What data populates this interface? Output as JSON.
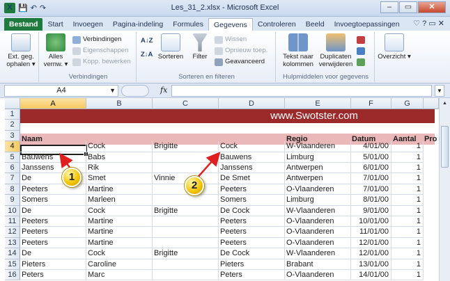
{
  "window": {
    "title": "Les_31_2.xlsx - Microsoft Excel",
    "minimize": "–",
    "restore": "▭",
    "close": "✕"
  },
  "qat": {
    "logo": "X",
    "save": "💾",
    "undo": "↶",
    "redo": "↷"
  },
  "tabs": [
    "Bestand",
    "Start",
    "Invoegen",
    "Pagina-indeling",
    "Formules",
    "Gegevens",
    "Controleren",
    "Beeld",
    "Invoegtoepassingen"
  ],
  "tabs_right": "♡ ? ▭ ✕",
  "ribbon": {
    "ext_label": "Ext. geg. ophalen ▾",
    "groups": {
      "verbindingen": {
        "label": "Verbindingen",
        "alles_vernw": "Alles vernw. ▾",
        "items": [
          "Verbindingen",
          "Eigenschappen",
          "Kopp. bewerken"
        ]
      },
      "sorteren": {
        "label": "Sorteren en filteren",
        "sort_az": "A↓Z",
        "sort_za": "Z↓A",
        "sorteren": "Sorteren",
        "filter": "Filter",
        "items": [
          "Wissen",
          "Opnieuw toep.",
          "Geavanceerd"
        ]
      },
      "hulpmiddelen": {
        "label": "Hulpmiddelen voor gegevens",
        "tekst_naar_kolommen": "Tekst naar kolommen",
        "duplicaten_verwijderen": "Duplicaten verwijderen"
      },
      "overzicht": {
        "label": "Overzicht ▾"
      }
    }
  },
  "formula_bar": {
    "name_box": "A4",
    "fx": "fx",
    "value": ""
  },
  "columns": [
    "A",
    "B",
    "C",
    "D",
    "E",
    "F",
    "G"
  ],
  "banner": "www.Swotster.com",
  "header_row": {
    "naam": "Naam",
    "regio": "Regio",
    "datum": "Datum",
    "aantal": "Aantal",
    "pro": "Pro"
  },
  "rows": [
    {
      "n": "1"
    },
    {
      "n": "2"
    },
    {
      "n": "3"
    },
    {
      "n": "4",
      "a": "",
      "b": "Cock",
      "c": "Brigitte",
      "d": "Cock",
      "e": "W-Vlaanderen",
      "f": "4/01/00",
      "g": "1"
    },
    {
      "n": "5",
      "a": "Bauwens",
      "b": "Babs",
      "c": "",
      "d": "Bauwens",
      "e": "Limburg",
      "f": "5/01/00",
      "g": "1"
    },
    {
      "n": "6",
      "a": "Janssens",
      "b": "Rik",
      "c": "",
      "d": "Janssens",
      "e": "Antwerpen",
      "f": "6/01/00",
      "g": "1"
    },
    {
      "n": "7",
      "a": "De",
      "b": "Smet",
      "c": "Vinnie",
      "d": "De Smet",
      "e": "Antwerpen",
      "f": "7/01/00",
      "g": "1"
    },
    {
      "n": "8",
      "a": "Peeters",
      "b": "Martine",
      "c": "",
      "d": "Peeters",
      "e": "O-Vlaanderen",
      "f": "7/01/00",
      "g": "1"
    },
    {
      "n": "9",
      "a": "Somers",
      "b": "Marleen",
      "c": "",
      "d": "Somers",
      "e": "Limburg",
      "f": "8/01/00",
      "g": "1"
    },
    {
      "n": "10",
      "a": "De",
      "b": "Cock",
      "c": "Brigitte",
      "d": "De Cock",
      "e": "W-Vlaanderen",
      "f": "9/01/00",
      "g": "1"
    },
    {
      "n": "11",
      "a": "Peeters",
      "b": "Martine",
      "c": "",
      "d": "Peeters",
      "e": "O-Vlaanderen",
      "f": "10/01/00",
      "g": "1"
    },
    {
      "n": "12",
      "a": "Peeters",
      "b": "Martine",
      "c": "",
      "d": "Peeters",
      "e": "O-Vlaanderen",
      "f": "11/01/00",
      "g": "1"
    },
    {
      "n": "13",
      "a": "Peeters",
      "b": "Martine",
      "c": "",
      "d": "Peeters",
      "e": "O-Vlaanderen",
      "f": "12/01/00",
      "g": "1"
    },
    {
      "n": "14",
      "a": "De",
      "b": "Cock",
      "c": "Brigitte",
      "d": "De Cock",
      "e": "W-Vlaanderen",
      "f": "12/01/00",
      "g": "1"
    },
    {
      "n": "15",
      "a": "Pieters",
      "b": "Caroline",
      "c": "",
      "d": "Pieters",
      "e": "Brabant",
      "f": "13/01/00",
      "g": "1"
    },
    {
      "n": "16",
      "a": "Peters",
      "b": "Marc",
      "c": "",
      "d": "Peters",
      "e": "O-Vlaanderen",
      "f": "14/01/00",
      "g": "1"
    }
  ],
  "callouts": {
    "one": "1",
    "two": "2"
  },
  "colors": {
    "banner": "#9c2a2a",
    "header_row": "#eab8b8",
    "file_tab": "#1f7a3e",
    "callout": "#f2c200"
  }
}
